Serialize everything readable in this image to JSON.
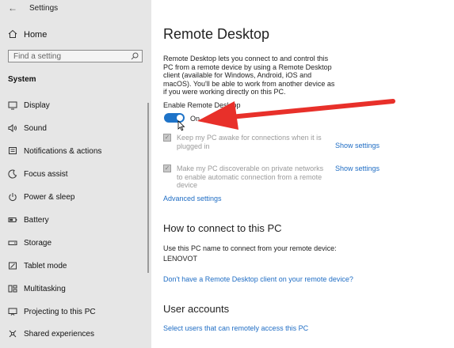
{
  "app": {
    "title": "Settings"
  },
  "sidebar": {
    "home_label": "Home",
    "search_placeholder": "Find a setting",
    "section_title": "System",
    "items": [
      {
        "label": "Display",
        "icon": "display-icon"
      },
      {
        "label": "Sound",
        "icon": "sound-icon"
      },
      {
        "label": "Notifications & actions",
        "icon": "notifications-icon"
      },
      {
        "label": "Focus assist",
        "icon": "focus-assist-icon"
      },
      {
        "label": "Power & sleep",
        "icon": "power-icon"
      },
      {
        "label": "Battery",
        "icon": "battery-icon"
      },
      {
        "label": "Storage",
        "icon": "storage-icon"
      },
      {
        "label": "Tablet mode",
        "icon": "tablet-mode-icon"
      },
      {
        "label": "Multitasking",
        "icon": "multitasking-icon"
      },
      {
        "label": "Projecting to this PC",
        "icon": "projecting-icon"
      },
      {
        "label": "Shared experiences",
        "icon": "shared-experiences-icon"
      }
    ]
  },
  "main": {
    "title": "Remote Desktop",
    "description": "Remote Desktop lets you connect to and control this PC from a remote device by using a Remote Desktop client (available for Windows, Android, iOS and macOS). You'll be able to work from another device as if you were working directly on this PC.",
    "enable_label": "Enable Remote Desktop",
    "toggle_state": "On",
    "options": [
      {
        "label": "Keep my PC awake for connections when it is plugged in",
        "link": "Show settings",
        "checked": true
      },
      {
        "label": "Make my PC discoverable on private networks to enable automatic connection from a remote device",
        "link": "Show settings",
        "checked": true
      }
    ],
    "advanced_link": "Advanced settings",
    "connect": {
      "heading": "How to connect to this PC",
      "instruction": "Use this PC name to connect from your remote device:",
      "pc_name": "LENOVOT",
      "client_link": "Don't have a Remote Desktop client on your remote device?"
    },
    "user_accounts": {
      "heading": "User accounts",
      "link": "Select users that can remotely access this PC"
    }
  },
  "colors": {
    "accent": "#1e73c8",
    "link": "#1f6dc4",
    "annotation_arrow": "#e8302a",
    "sidebar_bg": "#e6e6e6"
  }
}
